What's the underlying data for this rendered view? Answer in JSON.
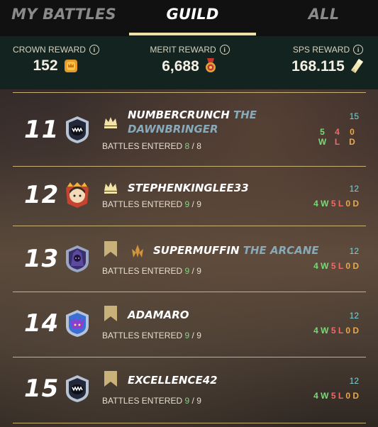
{
  "tabs": [
    {
      "label": "MY BATTLES",
      "active": false
    },
    {
      "label": "GUILD",
      "active": true
    },
    {
      "label": "ALL",
      "active": false
    }
  ],
  "rewards": {
    "crown": {
      "label": "CROWN REWARD",
      "value": "152",
      "icon": "crown-token-icon"
    },
    "merit": {
      "label": "MERIT REWARD",
      "value": "6,688",
      "icon": "merit-medal-icon"
    },
    "sps": {
      "label": "SPS REWARD",
      "value": "168.115",
      "icon": "sps-crystal-icon"
    }
  },
  "rows": [
    {
      "rank": "11",
      "name": "NUMBERCRUNCH",
      "title": "THE DAWNBRINGER",
      "entered_label": "BATTLES ENTERED",
      "entered": "8",
      "total": "8",
      "score": "15",
      "w": "5",
      "l": "4",
      "d": "0",
      "wl": "W",
      "ll": "L",
      "dl": "D"
    },
    {
      "rank": "12",
      "name": "STEPHENKINGLEE33",
      "title": "",
      "entered_label": "BATTLES ENTERED",
      "entered": "9",
      "total": "9",
      "score": "12",
      "w": "4 W",
      "l": "5 L",
      "d": "0 D"
    },
    {
      "rank": "13",
      "name": "SUPERMUFFIN",
      "title": "THE ARCANE",
      "entered_label": "BATTLES ENTERED",
      "entered": "9",
      "total": "9",
      "score": "12",
      "w": "4 W",
      "l": "5 L",
      "d": "0 D"
    },
    {
      "rank": "14",
      "name": "ADAMARO",
      "title": "",
      "entered_label": "BATTLES ENTERED",
      "entered": "9",
      "total": "9",
      "score": "12",
      "w": "4 W",
      "l": "5 L",
      "d": "0 D"
    },
    {
      "rank": "15",
      "name": "EXCELLENCE42",
      "title": "",
      "entered_label": "BATTLES ENTERED",
      "entered": "9",
      "total": "9",
      "score": "12",
      "w": "4 W",
      "l": "5 L",
      "d": "0 D"
    }
  ],
  "colors": {
    "accent": "#eedfa6",
    "win": "#7bd87b",
    "loss": "#ef6a6a",
    "draw": "#e5a853",
    "title": "#87aabb"
  }
}
